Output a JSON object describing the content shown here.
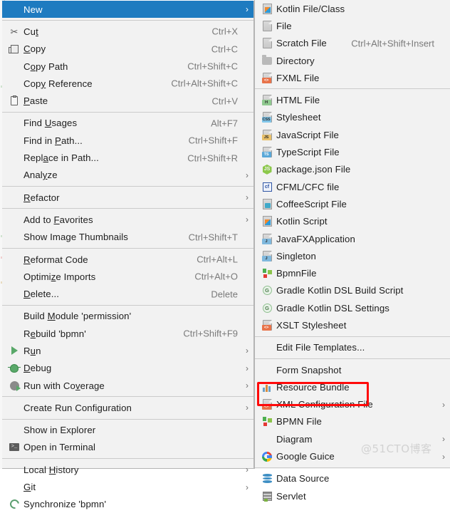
{
  "context_menu": {
    "name": "editor-context-menu",
    "groups": [
      {
        "items": [
          {
            "label": "New",
            "icon": "none",
            "accel": "",
            "arrow": true,
            "selected": true,
            "mnemonic": ""
          }
        ]
      },
      {
        "items": [
          {
            "label": "Cut",
            "icon": "scissors-icon",
            "accel": "Ctrl+X",
            "arrow": false,
            "mnemonic": "t"
          },
          {
            "label": "Copy",
            "icon": "copy-icon",
            "accel": "Ctrl+C",
            "arrow": false,
            "mnemonic": "C"
          },
          {
            "label": "Copy Path",
            "icon": "none",
            "accel": "Ctrl+Shift+C",
            "arrow": false,
            "mnemonic": "o"
          },
          {
            "label": "Copy Reference",
            "icon": "none",
            "accel": "Ctrl+Alt+Shift+C",
            "arrow": false,
            "mnemonic": "y"
          },
          {
            "label": "Paste",
            "icon": "clipboard-icon",
            "accel": "Ctrl+V",
            "arrow": false,
            "mnemonic": "P"
          }
        ]
      },
      {
        "items": [
          {
            "label": "Find Usages",
            "icon": "none",
            "accel": "Alt+F7",
            "arrow": false,
            "mnemonic": "U"
          },
          {
            "label": "Find in Path...",
            "icon": "none",
            "accel": "Ctrl+Shift+F",
            "arrow": false,
            "mnemonic": "P"
          },
          {
            "label": "Replace in Path...",
            "icon": "none",
            "accel": "Ctrl+Shift+R",
            "arrow": false,
            "mnemonic": "a"
          },
          {
            "label": "Analyze",
            "icon": "none",
            "accel": "",
            "arrow": true,
            "mnemonic": "y"
          }
        ]
      },
      {
        "items": [
          {
            "label": "Refactor",
            "icon": "none",
            "accel": "",
            "arrow": true,
            "mnemonic": "R"
          }
        ]
      },
      {
        "items": [
          {
            "label": "Add to Favorites",
            "icon": "none",
            "accel": "",
            "arrow": true,
            "mnemonic": "F"
          },
          {
            "label": "Show Image Thumbnails",
            "icon": "none",
            "accel": "Ctrl+Shift+T",
            "arrow": false,
            "mnemonic": ""
          }
        ]
      },
      {
        "items": [
          {
            "label": "Reformat Code",
            "icon": "none",
            "accel": "Ctrl+Alt+L",
            "arrow": false,
            "mnemonic": "R"
          },
          {
            "label": "Optimize Imports",
            "icon": "none",
            "accel": "Ctrl+Alt+O",
            "arrow": false,
            "mnemonic": "z"
          },
          {
            "label": "Delete...",
            "icon": "none",
            "accel": "Delete",
            "arrow": false,
            "mnemonic": "D"
          }
        ]
      },
      {
        "items": [
          {
            "label": "Build Module 'permission'",
            "icon": "none",
            "accel": "",
            "arrow": false,
            "mnemonic": "M"
          },
          {
            "label": "Rebuild 'bpmn'",
            "icon": "none",
            "accel": "Ctrl+Shift+F9",
            "arrow": false,
            "mnemonic": "e"
          },
          {
            "label": "Run",
            "icon": "run-icon",
            "accel": "",
            "arrow": true,
            "mnemonic": "u"
          },
          {
            "label": "Debug",
            "icon": "debug-icon",
            "accel": "",
            "arrow": true,
            "mnemonic": "D"
          },
          {
            "label": "Run with Coverage",
            "icon": "coverage-icon",
            "accel": "",
            "arrow": true,
            "mnemonic": "v"
          }
        ]
      },
      {
        "items": [
          {
            "label": "Create Run Configuration",
            "icon": "none",
            "accel": "",
            "arrow": true,
            "mnemonic": ""
          }
        ]
      },
      {
        "items": [
          {
            "label": "Show in Explorer",
            "icon": "none",
            "accel": "",
            "arrow": false,
            "mnemonic": ""
          },
          {
            "label": "Open in Terminal",
            "icon": "terminal-icon",
            "accel": "",
            "arrow": false,
            "mnemonic": ""
          }
        ]
      },
      {
        "items": [
          {
            "label": "Local History",
            "icon": "none",
            "accel": "",
            "arrow": true,
            "mnemonic": "H"
          },
          {
            "label": "Git",
            "icon": "none",
            "accel": "",
            "arrow": true,
            "mnemonic": "G"
          },
          {
            "label": "Synchronize 'bpmn'",
            "icon": "sync-icon",
            "accel": "",
            "arrow": false,
            "mnemonic": ""
          }
        ]
      }
    ]
  },
  "new_submenu": {
    "name": "new-file-submenu",
    "groups": [
      {
        "items": [
          {
            "label": "Kotlin File/Class",
            "icon": "kotlin-file-icon",
            "accel": "",
            "arrow": false
          },
          {
            "label": "File",
            "icon": "file-icon",
            "accel": "",
            "arrow": false
          },
          {
            "label": "Scratch File",
            "icon": "scratch-file-icon",
            "accel": "Ctrl+Alt+Shift+Insert",
            "arrow": false
          },
          {
            "label": "Directory",
            "icon": "folder-icon",
            "accel": "",
            "arrow": false
          },
          {
            "label": "FXML File",
            "icon": "fxml-file-icon",
            "accel": "",
            "arrow": false
          }
        ]
      },
      {
        "items": [
          {
            "label": "HTML File",
            "icon": "html-file-icon",
            "accel": "",
            "arrow": false
          },
          {
            "label": "Stylesheet",
            "icon": "css-file-icon",
            "accel": "",
            "arrow": false
          },
          {
            "label": "JavaScript File",
            "icon": "js-file-icon",
            "accel": "",
            "arrow": false
          },
          {
            "label": "TypeScript File",
            "icon": "ts-file-icon",
            "accel": "",
            "arrow": false
          },
          {
            "label": "package.json File",
            "icon": "node-icon",
            "accel": "",
            "arrow": false
          },
          {
            "label": "CFML/CFC file",
            "icon": "cfml-icon",
            "accel": "",
            "arrow": false
          },
          {
            "label": "CoffeeScript File",
            "icon": "coffeescript-icon",
            "accel": "",
            "arrow": false
          },
          {
            "label": "Kotlin Script",
            "icon": "kotlin-script-icon",
            "accel": "",
            "arrow": false
          },
          {
            "label": "JavaFXApplication",
            "icon": "java-file-icon",
            "accel": "",
            "arrow": false
          },
          {
            "label": "Singleton",
            "icon": "java-file-icon",
            "accel": "",
            "arrow": false
          },
          {
            "label": "BpmnFile",
            "icon": "bpmn-icon",
            "accel": "",
            "arrow": false
          },
          {
            "label": "Gradle Kotlin DSL Build Script",
            "icon": "gradle-icon",
            "accel": "",
            "arrow": false
          },
          {
            "label": "Gradle Kotlin DSL Settings",
            "icon": "gradle-icon",
            "accel": "",
            "arrow": false
          },
          {
            "label": "XSLT Stylesheet",
            "icon": "xslt-file-icon",
            "accel": "",
            "arrow": false
          }
        ]
      },
      {
        "items": [
          {
            "label": "Edit File Templates...",
            "icon": "none",
            "accel": "",
            "arrow": false
          }
        ]
      },
      {
        "items": [
          {
            "label": "Form Snapshot",
            "icon": "none",
            "accel": "",
            "arrow": false
          },
          {
            "label": "Resource Bundle",
            "icon": "resource-bundle-icon",
            "accel": "",
            "arrow": false
          },
          {
            "label": "XML Configuration File",
            "icon": "xml-file-icon",
            "accel": "",
            "arrow": true
          },
          {
            "label": "BPMN File",
            "icon": "bpmn-icon",
            "accel": "",
            "arrow": false,
            "highlighted": true
          },
          {
            "label": "Diagram",
            "icon": "none",
            "accel": "",
            "arrow": true
          },
          {
            "label": "Google Guice",
            "icon": "google-icon",
            "accel": "",
            "arrow": true
          }
        ]
      },
      {
        "items": [
          {
            "label": "Data Source",
            "icon": "data-source-icon",
            "accel": "",
            "arrow": false
          },
          {
            "label": "Servlet",
            "icon": "servlet-icon",
            "accel": "",
            "arrow": false
          }
        ]
      }
    ]
  },
  "annotation": {
    "highlight_box": {
      "name": "bpmn-file-highlight-box",
      "color": "#ff0a0a"
    }
  },
  "watermark": {
    "text": "@51CTO博客",
    "color": "#d2d2d2"
  },
  "colors": {
    "menu_background": "#f2f2f2",
    "selection_blue": "#1e7bc0",
    "separator": "#cbcbcb",
    "text": "#1d1d1d",
    "accel_text": "#7a7a7a"
  }
}
